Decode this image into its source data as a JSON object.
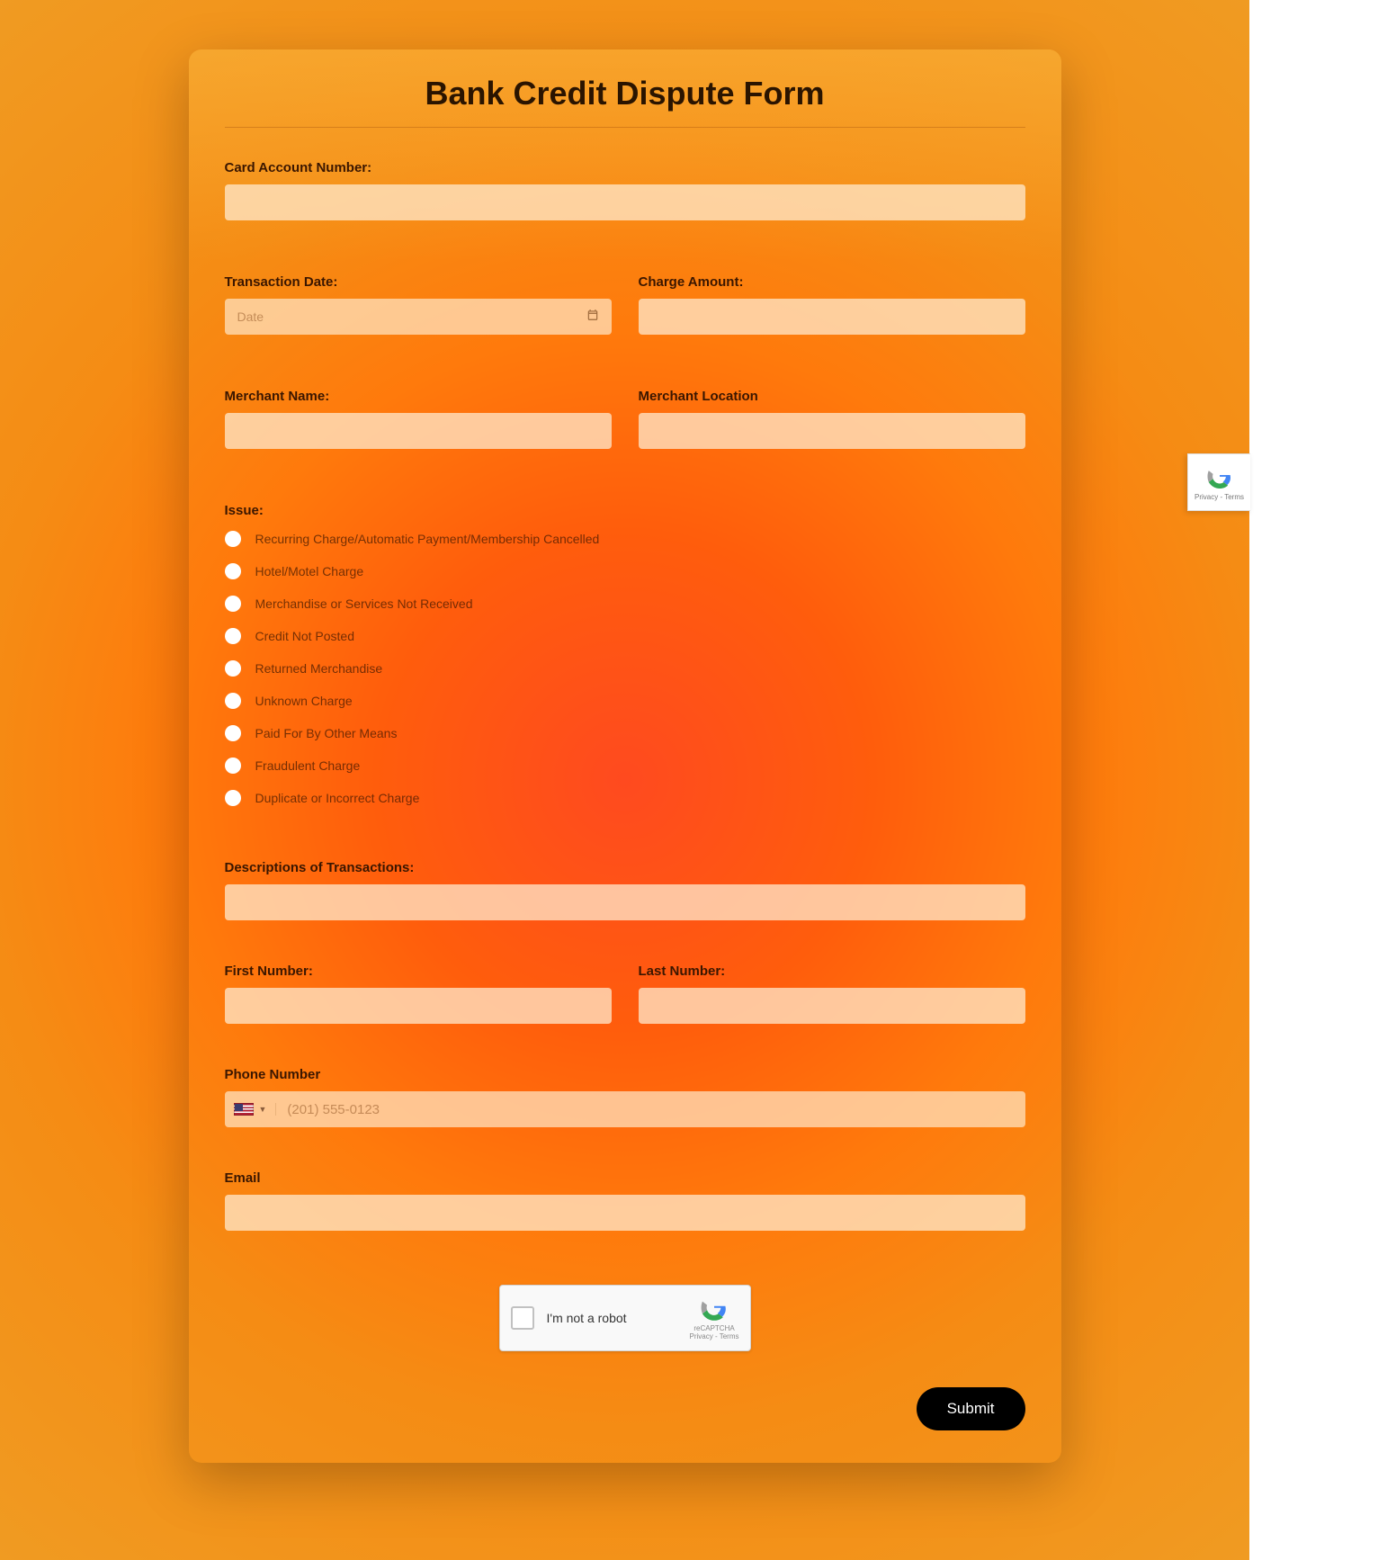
{
  "title": "Bank Credit Dispute Form",
  "fields": {
    "card_account_number": {
      "label": "Card Account Number:"
    },
    "transaction_date": {
      "label": "Transaction Date:",
      "placeholder": "Date"
    },
    "charge_amount": {
      "label": "Charge Amount:"
    },
    "merchant_name": {
      "label": "Merchant Name:"
    },
    "merchant_location": {
      "label": "Merchant Location"
    },
    "issue": {
      "label": "Issue:"
    },
    "descriptions": {
      "label": "Descriptions of Transactions:"
    },
    "first_number": {
      "label": "First Number:"
    },
    "last_number": {
      "label": "Last Number:"
    },
    "phone": {
      "label": "Phone Number",
      "placeholder": "(201) 555-0123"
    },
    "email": {
      "label": "Email"
    }
  },
  "issue_options": [
    "Recurring Charge/Automatic Payment/Membership Cancelled",
    "Hotel/Motel Charge",
    "Merchandise or Services Not Received",
    "Credit Not Posted",
    "Returned Merchandise",
    "Unknown Charge",
    "Paid For By Other Means",
    "Fraudulent Charge",
    "Duplicate or Incorrect Charge"
  ],
  "captcha": {
    "text": "I'm not a robot",
    "brand": "reCAPTCHA",
    "legal": "Privacy - Terms"
  },
  "submit_label": "Submit"
}
